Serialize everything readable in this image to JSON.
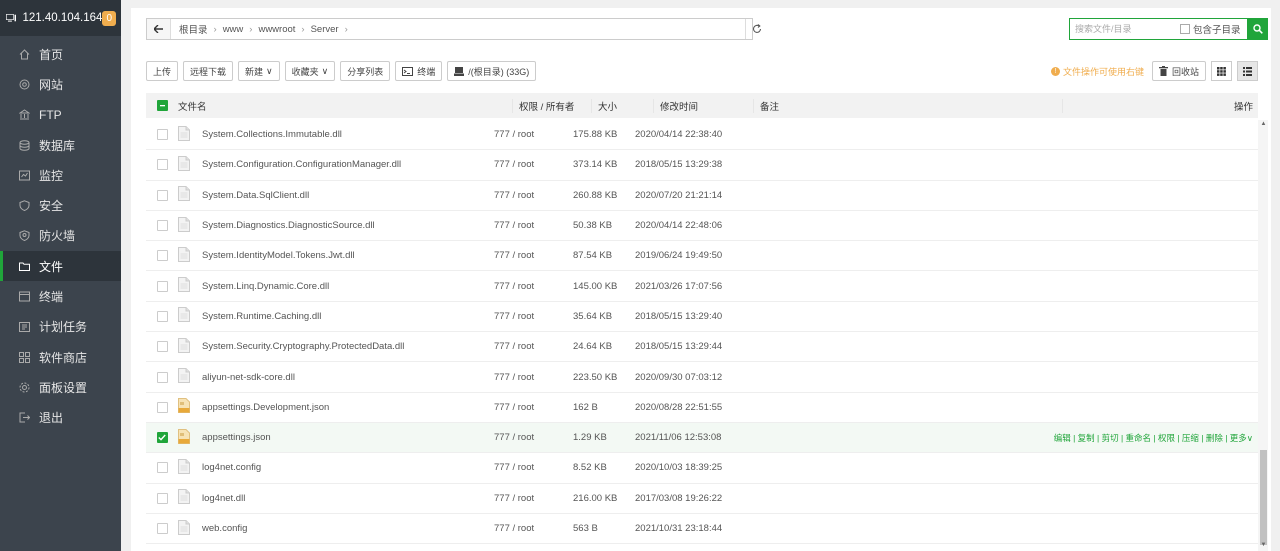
{
  "sidebar": {
    "server_ip": "121.40.104.164",
    "badge": "0",
    "items": [
      {
        "label": "首页",
        "icon": "home-icon"
      },
      {
        "label": "网站",
        "icon": "globe-icon"
      },
      {
        "label": "FTP",
        "icon": "ftp-icon"
      },
      {
        "label": "数据库",
        "icon": "database-icon"
      },
      {
        "label": "监控",
        "icon": "monitor-icon"
      },
      {
        "label": "安全",
        "icon": "shield-icon"
      },
      {
        "label": "防火墙",
        "icon": "firewall-icon"
      },
      {
        "label": "文件",
        "icon": "folder-icon",
        "active": true
      },
      {
        "label": "终端",
        "icon": "terminal-icon"
      },
      {
        "label": "计划任务",
        "icon": "calendar-icon"
      },
      {
        "label": "软件商店",
        "icon": "apps-icon"
      },
      {
        "label": "面板设置",
        "icon": "gear-icon"
      },
      {
        "label": "退出",
        "icon": "logout-icon"
      }
    ]
  },
  "path": {
    "crumbs": [
      "根目录",
      "www",
      "wwwroot",
      "Server"
    ]
  },
  "search": {
    "placeholder": "搜索文件/目录",
    "include_sub_label": "包含子目录"
  },
  "toolbar": {
    "upload": "上传",
    "remote_download": "远程下载",
    "new": "新建",
    "favorites": "收藏夹",
    "share_list": "分享列表",
    "terminal": "终端",
    "disk": "/(根目录) (33G)",
    "hint": "文件操作可使用右键",
    "recycle": "回收站"
  },
  "table": {
    "headers": {
      "name": "文件名",
      "perm": "权限 / 所有者",
      "size": "大小",
      "time": "修改时间",
      "note": "备注",
      "op": "操作"
    },
    "rows": [
      {
        "name": "System.Collections.Immutable.dll",
        "perm": "777 / root",
        "size": "175.88 KB",
        "time": "2020/04/14 22:38:40",
        "type": "file"
      },
      {
        "name": "System.Configuration.ConfigurationManager.dll",
        "perm": "777 / root",
        "size": "373.14 KB",
        "time": "2018/05/15 13:29:38",
        "type": "file"
      },
      {
        "name": "System.Data.SqlClient.dll",
        "perm": "777 / root",
        "size": "260.88 KB",
        "time": "2020/07/20 21:21:14",
        "type": "file"
      },
      {
        "name": "System.Diagnostics.DiagnosticSource.dll",
        "perm": "777 / root",
        "size": "50.38 KB",
        "time": "2020/04/14 22:48:06",
        "type": "file"
      },
      {
        "name": "System.IdentityModel.Tokens.Jwt.dll",
        "perm": "777 / root",
        "size": "87.54 KB",
        "time": "2019/06/24 19:49:50",
        "type": "file"
      },
      {
        "name": "System.Linq.Dynamic.Core.dll",
        "perm": "777 / root",
        "size": "145.00 KB",
        "time": "2021/03/26 17:07:56",
        "type": "file"
      },
      {
        "name": "System.Runtime.Caching.dll",
        "perm": "777 / root",
        "size": "35.64 KB",
        "time": "2018/05/15 13:29:40",
        "type": "file"
      },
      {
        "name": "System.Security.Cryptography.ProtectedData.dll",
        "perm": "777 / root",
        "size": "24.64 KB",
        "time": "2018/05/15 13:29:44",
        "type": "file"
      },
      {
        "name": "aliyun-net-sdk-core.dll",
        "perm": "777 / root",
        "size": "223.50 KB",
        "time": "2020/09/30 07:03:12",
        "type": "file"
      },
      {
        "name": "appsettings.Development.json",
        "perm": "777 / root",
        "size": "162 B",
        "time": "2020/08/28 22:51:55",
        "type": "json"
      },
      {
        "name": "appsettings.json",
        "perm": "777 / root",
        "size": "1.29 KB",
        "time": "2021/11/06 12:53:08",
        "type": "json",
        "selected": true
      },
      {
        "name": "log4net.config",
        "perm": "777 / root",
        "size": "8.52 KB",
        "time": "2020/10/03 18:39:25",
        "type": "file"
      },
      {
        "name": "log4net.dll",
        "perm": "777 / root",
        "size": "216.00 KB",
        "time": "2017/03/08 19:26:22",
        "type": "file"
      },
      {
        "name": "web.config",
        "perm": "777 / root",
        "size": "563 B",
        "time": "2021/10/31 23:18:44",
        "type": "file"
      }
    ],
    "row_ops": "编辑 | 复制 | 剪切 | 重命名 | 权限 | 压缩 | 删除 | 更多∨"
  },
  "colors": {
    "accent": "#20a53a",
    "sidebar": "#3c444d",
    "warning": "#f0ad4e"
  }
}
